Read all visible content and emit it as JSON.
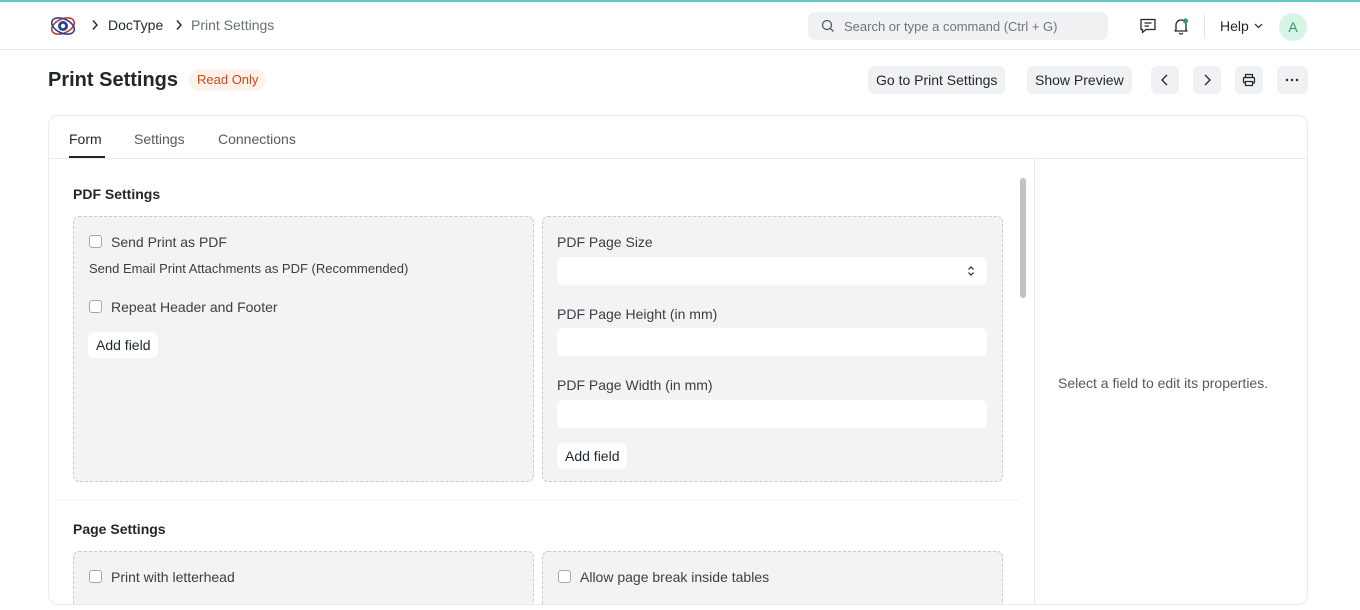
{
  "navbar": {
    "breadcrumbs": [
      "DocType",
      "Print Settings"
    ],
    "search_placeholder": "Search or type a command (Ctrl + G)",
    "help_label": "Help",
    "avatar_initial": "A"
  },
  "page": {
    "title": "Print Settings",
    "status_badge": "Read Only",
    "actions": {
      "go_to": "Go to Print Settings",
      "show_preview": "Show Preview"
    }
  },
  "tabs": [
    {
      "label": "Form",
      "active": true
    },
    {
      "label": "Settings",
      "active": false
    },
    {
      "label": "Connections",
      "active": false
    }
  ],
  "sections": [
    {
      "title": "PDF Settings",
      "left_column": {
        "checkboxes": [
          {
            "label": "Send Print as PDF",
            "description": "Send Email Print Attachments as PDF (Recommended)"
          },
          {
            "label": "Repeat Header and Footer"
          }
        ],
        "add_field": "Add field"
      },
      "right_column": {
        "fields": [
          {
            "label": "PDF Page Size",
            "type": "select",
            "value": ""
          },
          {
            "label": "PDF Page Height (in mm)",
            "type": "text",
            "value": ""
          },
          {
            "label": "PDF Page Width (in mm)",
            "type": "text",
            "value": ""
          }
        ],
        "add_field": "Add field"
      }
    },
    {
      "title": "Page Settings",
      "left_column": {
        "checkboxes": [
          {
            "label": "Print with letterhead"
          }
        ]
      },
      "right_column": {
        "checkboxes": [
          {
            "label": "Allow page break inside tables"
          }
        ]
      }
    }
  ],
  "side_panel": {
    "message": "Select a field to edit its properties."
  },
  "colors": {
    "accent_top": "#66c7c4",
    "badge_bg": "#fff2ea",
    "badge_text": "#c94c1e",
    "avatar_bg": "#d6f5e6",
    "avatar_text": "#2e9b5f"
  }
}
